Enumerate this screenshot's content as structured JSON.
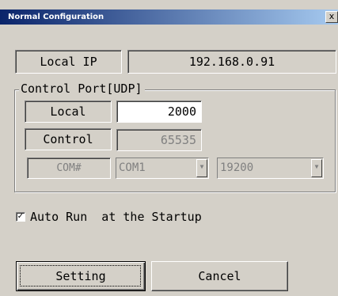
{
  "window": {
    "title": "Normal Configuration",
    "close_glyph": "x"
  },
  "network": {
    "local_ip_label": "Local IP",
    "local_ip_value": "192.168.0.91"
  },
  "control_port": {
    "group_title": "Control Port[UDP]",
    "local_label": "Local",
    "local_value": "2000",
    "control_label": "Control",
    "control_value": "65535",
    "com_label": "COM#",
    "com_port_selected": "COM1",
    "baud_selected": "19200"
  },
  "options": {
    "auto_run_label": "Auto Run  at the Startup",
    "auto_run_checked": true,
    "check_glyph": "☑"
  },
  "buttons": {
    "setting_label": "Setting",
    "cancel_label": "Cancel"
  },
  "icons": {
    "combo_arrow": "chevron-down-icon",
    "close": "close-icon"
  },
  "colors": {
    "dialog_face": "#d4d0c8",
    "titlebar_start": "#0a246a",
    "titlebar_end": "#a6caf0",
    "disabled_text": "#808080"
  }
}
